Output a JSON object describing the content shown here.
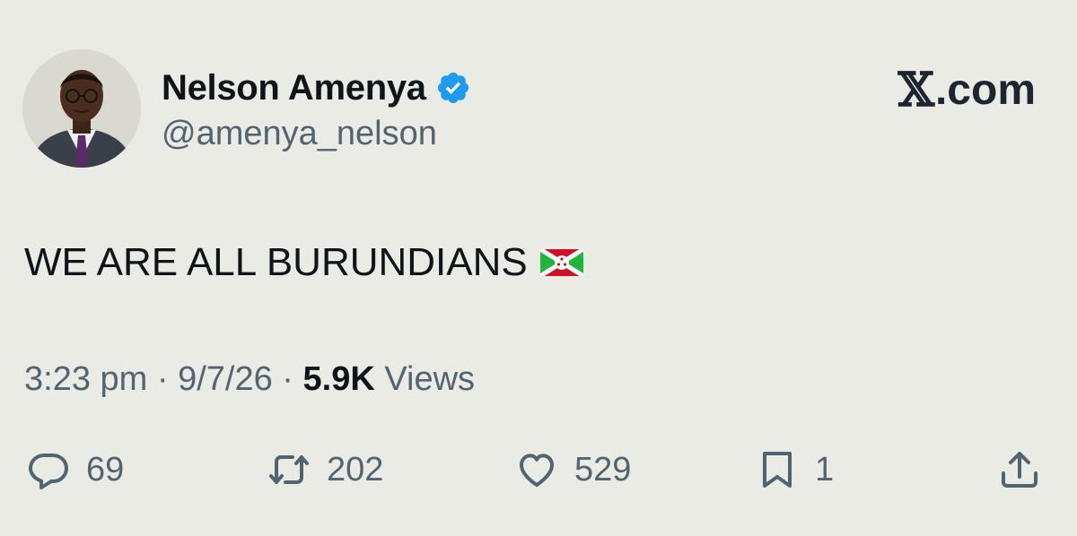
{
  "author": {
    "display_name": "Nelson Amenya",
    "handle": "@amenya_nelson",
    "verified_icon": "verified-badge-icon",
    "avatar": "profile-photo"
  },
  "brand": {
    "x_glyph": "𝕏",
    "domain": ".com"
  },
  "tweet": {
    "text": "WE ARE ALL BURUNDIANS",
    "flag_icon": "burundi-flag-icon"
  },
  "meta": {
    "time": "3:23 pm",
    "separator": " · ",
    "date": "9/7/26",
    "views_count": "5.9K",
    "views_label": " Views"
  },
  "actions": {
    "replies": "69",
    "reposts": "202",
    "likes": "529",
    "bookmarks": "1",
    "share_icon": "share-icon"
  },
  "colors": {
    "background": "#ebebe5",
    "text": "#0f1419",
    "secondary": "#536471",
    "verified": "#1d9bf0"
  }
}
